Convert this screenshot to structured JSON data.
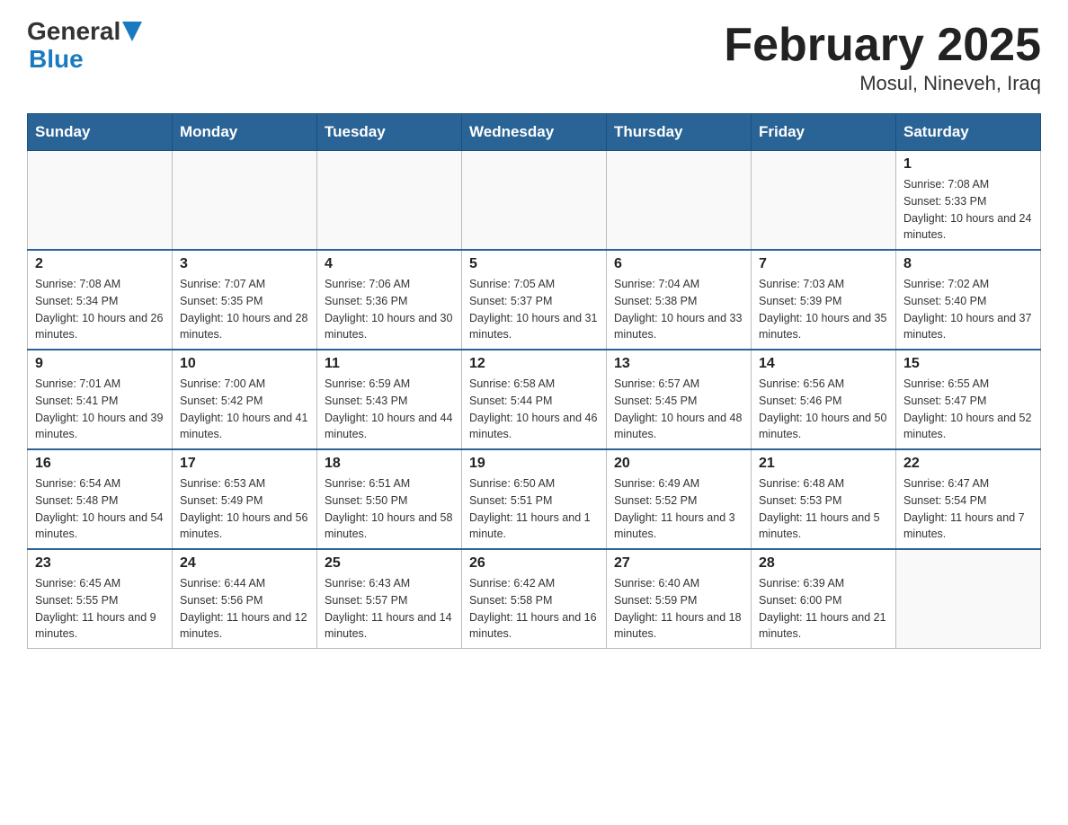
{
  "header": {
    "logo_general": "General",
    "logo_blue": "Blue",
    "title": "February 2025",
    "subtitle": "Mosul, Nineveh, Iraq"
  },
  "days_of_week": [
    "Sunday",
    "Monday",
    "Tuesday",
    "Wednesday",
    "Thursday",
    "Friday",
    "Saturday"
  ],
  "weeks": [
    [
      {
        "day": "",
        "info": ""
      },
      {
        "day": "",
        "info": ""
      },
      {
        "day": "",
        "info": ""
      },
      {
        "day": "",
        "info": ""
      },
      {
        "day": "",
        "info": ""
      },
      {
        "day": "",
        "info": ""
      },
      {
        "day": "1",
        "info": "Sunrise: 7:08 AM\nSunset: 5:33 PM\nDaylight: 10 hours and 24 minutes."
      }
    ],
    [
      {
        "day": "2",
        "info": "Sunrise: 7:08 AM\nSunset: 5:34 PM\nDaylight: 10 hours and 26 minutes."
      },
      {
        "day": "3",
        "info": "Sunrise: 7:07 AM\nSunset: 5:35 PM\nDaylight: 10 hours and 28 minutes."
      },
      {
        "day": "4",
        "info": "Sunrise: 7:06 AM\nSunset: 5:36 PM\nDaylight: 10 hours and 30 minutes."
      },
      {
        "day": "5",
        "info": "Sunrise: 7:05 AM\nSunset: 5:37 PM\nDaylight: 10 hours and 31 minutes."
      },
      {
        "day": "6",
        "info": "Sunrise: 7:04 AM\nSunset: 5:38 PM\nDaylight: 10 hours and 33 minutes."
      },
      {
        "day": "7",
        "info": "Sunrise: 7:03 AM\nSunset: 5:39 PM\nDaylight: 10 hours and 35 minutes."
      },
      {
        "day": "8",
        "info": "Sunrise: 7:02 AM\nSunset: 5:40 PM\nDaylight: 10 hours and 37 minutes."
      }
    ],
    [
      {
        "day": "9",
        "info": "Sunrise: 7:01 AM\nSunset: 5:41 PM\nDaylight: 10 hours and 39 minutes."
      },
      {
        "day": "10",
        "info": "Sunrise: 7:00 AM\nSunset: 5:42 PM\nDaylight: 10 hours and 41 minutes."
      },
      {
        "day": "11",
        "info": "Sunrise: 6:59 AM\nSunset: 5:43 PM\nDaylight: 10 hours and 44 minutes."
      },
      {
        "day": "12",
        "info": "Sunrise: 6:58 AM\nSunset: 5:44 PM\nDaylight: 10 hours and 46 minutes."
      },
      {
        "day": "13",
        "info": "Sunrise: 6:57 AM\nSunset: 5:45 PM\nDaylight: 10 hours and 48 minutes."
      },
      {
        "day": "14",
        "info": "Sunrise: 6:56 AM\nSunset: 5:46 PM\nDaylight: 10 hours and 50 minutes."
      },
      {
        "day": "15",
        "info": "Sunrise: 6:55 AM\nSunset: 5:47 PM\nDaylight: 10 hours and 52 minutes."
      }
    ],
    [
      {
        "day": "16",
        "info": "Sunrise: 6:54 AM\nSunset: 5:48 PM\nDaylight: 10 hours and 54 minutes."
      },
      {
        "day": "17",
        "info": "Sunrise: 6:53 AM\nSunset: 5:49 PM\nDaylight: 10 hours and 56 minutes."
      },
      {
        "day": "18",
        "info": "Sunrise: 6:51 AM\nSunset: 5:50 PM\nDaylight: 10 hours and 58 minutes."
      },
      {
        "day": "19",
        "info": "Sunrise: 6:50 AM\nSunset: 5:51 PM\nDaylight: 11 hours and 1 minute."
      },
      {
        "day": "20",
        "info": "Sunrise: 6:49 AM\nSunset: 5:52 PM\nDaylight: 11 hours and 3 minutes."
      },
      {
        "day": "21",
        "info": "Sunrise: 6:48 AM\nSunset: 5:53 PM\nDaylight: 11 hours and 5 minutes."
      },
      {
        "day": "22",
        "info": "Sunrise: 6:47 AM\nSunset: 5:54 PM\nDaylight: 11 hours and 7 minutes."
      }
    ],
    [
      {
        "day": "23",
        "info": "Sunrise: 6:45 AM\nSunset: 5:55 PM\nDaylight: 11 hours and 9 minutes."
      },
      {
        "day": "24",
        "info": "Sunrise: 6:44 AM\nSunset: 5:56 PM\nDaylight: 11 hours and 12 minutes."
      },
      {
        "day": "25",
        "info": "Sunrise: 6:43 AM\nSunset: 5:57 PM\nDaylight: 11 hours and 14 minutes."
      },
      {
        "day": "26",
        "info": "Sunrise: 6:42 AM\nSunset: 5:58 PM\nDaylight: 11 hours and 16 minutes."
      },
      {
        "day": "27",
        "info": "Sunrise: 6:40 AM\nSunset: 5:59 PM\nDaylight: 11 hours and 18 minutes."
      },
      {
        "day": "28",
        "info": "Sunrise: 6:39 AM\nSunset: 6:00 PM\nDaylight: 11 hours and 21 minutes."
      },
      {
        "day": "",
        "info": ""
      }
    ]
  ]
}
